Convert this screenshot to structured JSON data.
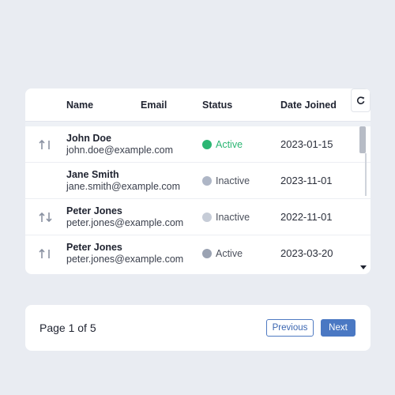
{
  "table": {
    "columns": {
      "name": "Name",
      "email": "Email",
      "status": "Status",
      "date_joined": "Date Joined"
    },
    "refresh_icon": "refresh-icon",
    "rows": [
      {
        "name": "John Doe",
        "email": "john.doe@example.com",
        "status": "Active",
        "status_color": "#2bb673",
        "status_text_color": "#2bb673",
        "date": "2023-01-15",
        "sort_icon": "sort-up-icon"
      },
      {
        "name": "Jane Smith",
        "email": "jane.smith@example.com",
        "status": "Inactive",
        "status_color": "#aeb6c6",
        "status_text_color": "#4b505c",
        "date": "2023-11-01",
        "sort_icon": null
      },
      {
        "name": "Peter Jones",
        "email": "peter.jones@example.com",
        "status": "Inactive",
        "status_color": "#c6ccd7",
        "status_text_color": "#4b505c",
        "date": "2022-11-01",
        "sort_icon": "sort-both-icon"
      },
      {
        "name": "Peter Jones",
        "email": "peter.jones@example.com",
        "status": "Active",
        "status_color": "#9aa2b2",
        "status_text_color": "#4b505c",
        "date": "2023-03-20",
        "sort_icon": "sort-up-icon"
      }
    ]
  },
  "pagination": {
    "label": "Page 1 of 5",
    "previous_label": "Previous",
    "next_label": "Next"
  },
  "colors": {
    "background": "#e9ecf2",
    "accent": "#4a78c3",
    "active": "#2bb673"
  }
}
